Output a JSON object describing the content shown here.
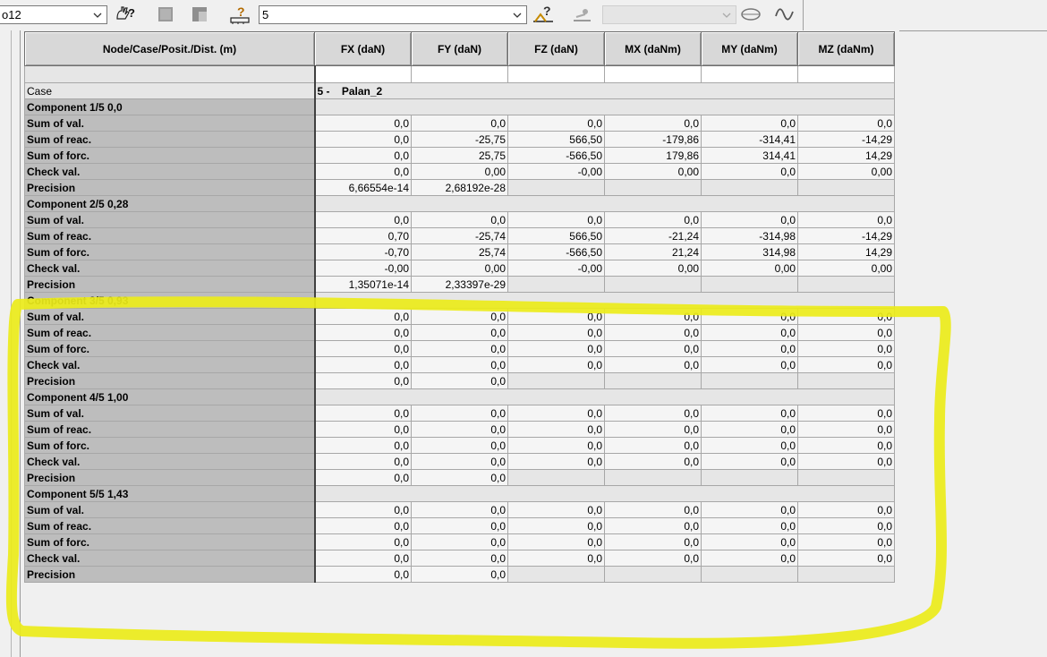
{
  "toolbar": {
    "node_combo_value": "o12",
    "case_combo_value": "5",
    "disabled_combo_value": ""
  },
  "table": {
    "headers": [
      "Node/Case/Posit./Dist. (m)",
      "FX (daN)",
      "FY (daN)",
      "FZ (daN)",
      "MX (daNm)",
      "MY (daNm)",
      "MZ (daNm)"
    ],
    "case_label": "Case",
    "case_number": "5 -",
    "case_name": "Palan_2",
    "components": [
      {
        "title": "Component 1/5  0,0",
        "rows": [
          {
            "label": "Sum of val.",
            "values": [
              "0,0",
              "0,0",
              "0,0",
              "0,0",
              "0,0",
              "0,0"
            ]
          },
          {
            "label": "Sum of reac.",
            "values": [
              "0,0",
              "-25,75",
              "566,50",
              "-179,86",
              "-314,41",
              "-14,29"
            ]
          },
          {
            "label": "Sum of forc.",
            "values": [
              "0,0",
              "25,75",
              "-566,50",
              "179,86",
              "314,41",
              "14,29"
            ]
          },
          {
            "label": "Check val.",
            "values": [
              "0,0",
              "0,00",
              "-0,00",
              "0,00",
              "0,0",
              "0,00"
            ]
          },
          {
            "label": "Precision",
            "values": [
              "6,66554e-14",
              "2,68192e-28",
              "",
              "",
              "",
              ""
            ]
          }
        ]
      },
      {
        "title": "Component 2/5  0,28",
        "rows": [
          {
            "label": "Sum of val.",
            "values": [
              "0,0",
              "0,0",
              "0,0",
              "0,0",
              "0,0",
              "0,0"
            ]
          },
          {
            "label": "Sum of reac.",
            "values": [
              "0,70",
              "-25,74",
              "566,50",
              "-21,24",
              "-314,98",
              "-14,29"
            ]
          },
          {
            "label": "Sum of forc.",
            "values": [
              "-0,70",
              "25,74",
              "-566,50",
              "21,24",
              "314,98",
              "14,29"
            ]
          },
          {
            "label": "Check val.",
            "values": [
              "-0,00",
              "0,00",
              "-0,00",
              "0,00",
              "0,00",
              "0,00"
            ]
          },
          {
            "label": "Precision",
            "values": [
              "1,35071e-14",
              "2,33397e-29",
              "",
              "",
              "",
              ""
            ]
          }
        ]
      },
      {
        "title": "Component 3/5  0,93",
        "rows": [
          {
            "label": "Sum of val.",
            "values": [
              "0,0",
              "0,0",
              "0,0",
              "0,0",
              "0,0",
              "0,0"
            ]
          },
          {
            "label": "Sum of reac.",
            "values": [
              "0,0",
              "0,0",
              "0,0",
              "0,0",
              "0,0",
              "0,0"
            ]
          },
          {
            "label": "Sum of forc.",
            "values": [
              "0,0",
              "0,0",
              "0,0",
              "0,0",
              "0,0",
              "0,0"
            ]
          },
          {
            "label": "Check val.",
            "values": [
              "0,0",
              "0,0",
              "0,0",
              "0,0",
              "0,0",
              "0,0"
            ]
          },
          {
            "label": "Precision",
            "values": [
              "0,0",
              "0,0",
              "",
              "",
              "",
              ""
            ]
          }
        ]
      },
      {
        "title": "Component 4/5  1,00",
        "rows": [
          {
            "label": "Sum of val.",
            "values": [
              "0,0",
              "0,0",
              "0,0",
              "0,0",
              "0,0",
              "0,0"
            ]
          },
          {
            "label": "Sum of reac.",
            "values": [
              "0,0",
              "0,0",
              "0,0",
              "0,0",
              "0,0",
              "0,0"
            ]
          },
          {
            "label": "Sum of forc.",
            "values": [
              "0,0",
              "0,0",
              "0,0",
              "0,0",
              "0,0",
              "0,0"
            ]
          },
          {
            "label": "Check val.",
            "values": [
              "0,0",
              "0,0",
              "0,0",
              "0,0",
              "0,0",
              "0,0"
            ]
          },
          {
            "label": "Precision",
            "values": [
              "0,0",
              "0,0",
              "",
              "",
              "",
              ""
            ]
          }
        ]
      },
      {
        "title": "Component 5/5  1,43",
        "rows": [
          {
            "label": "Sum of val.",
            "values": [
              "0,0",
              "0,0",
              "0,0",
              "0,0",
              "0,0",
              "0,0"
            ]
          },
          {
            "label": "Sum of reac.",
            "values": [
              "0,0",
              "0,0",
              "0,0",
              "0,0",
              "0,0",
              "0,0"
            ]
          },
          {
            "label": "Sum of forc.",
            "values": [
              "0,0",
              "0,0",
              "0,0",
              "0,0",
              "0,0",
              "0,0"
            ]
          },
          {
            "label": "Check val.",
            "values": [
              "0,0",
              "0,0",
              "0,0",
              "0,0",
              "0,0",
              "0,0"
            ]
          },
          {
            "label": "Precision",
            "values": [
              "0,0",
              "0,0",
              "",
              "",
              "",
              ""
            ]
          }
        ]
      }
    ]
  },
  "colors": {
    "highlight_marker": "#ecec1a"
  }
}
